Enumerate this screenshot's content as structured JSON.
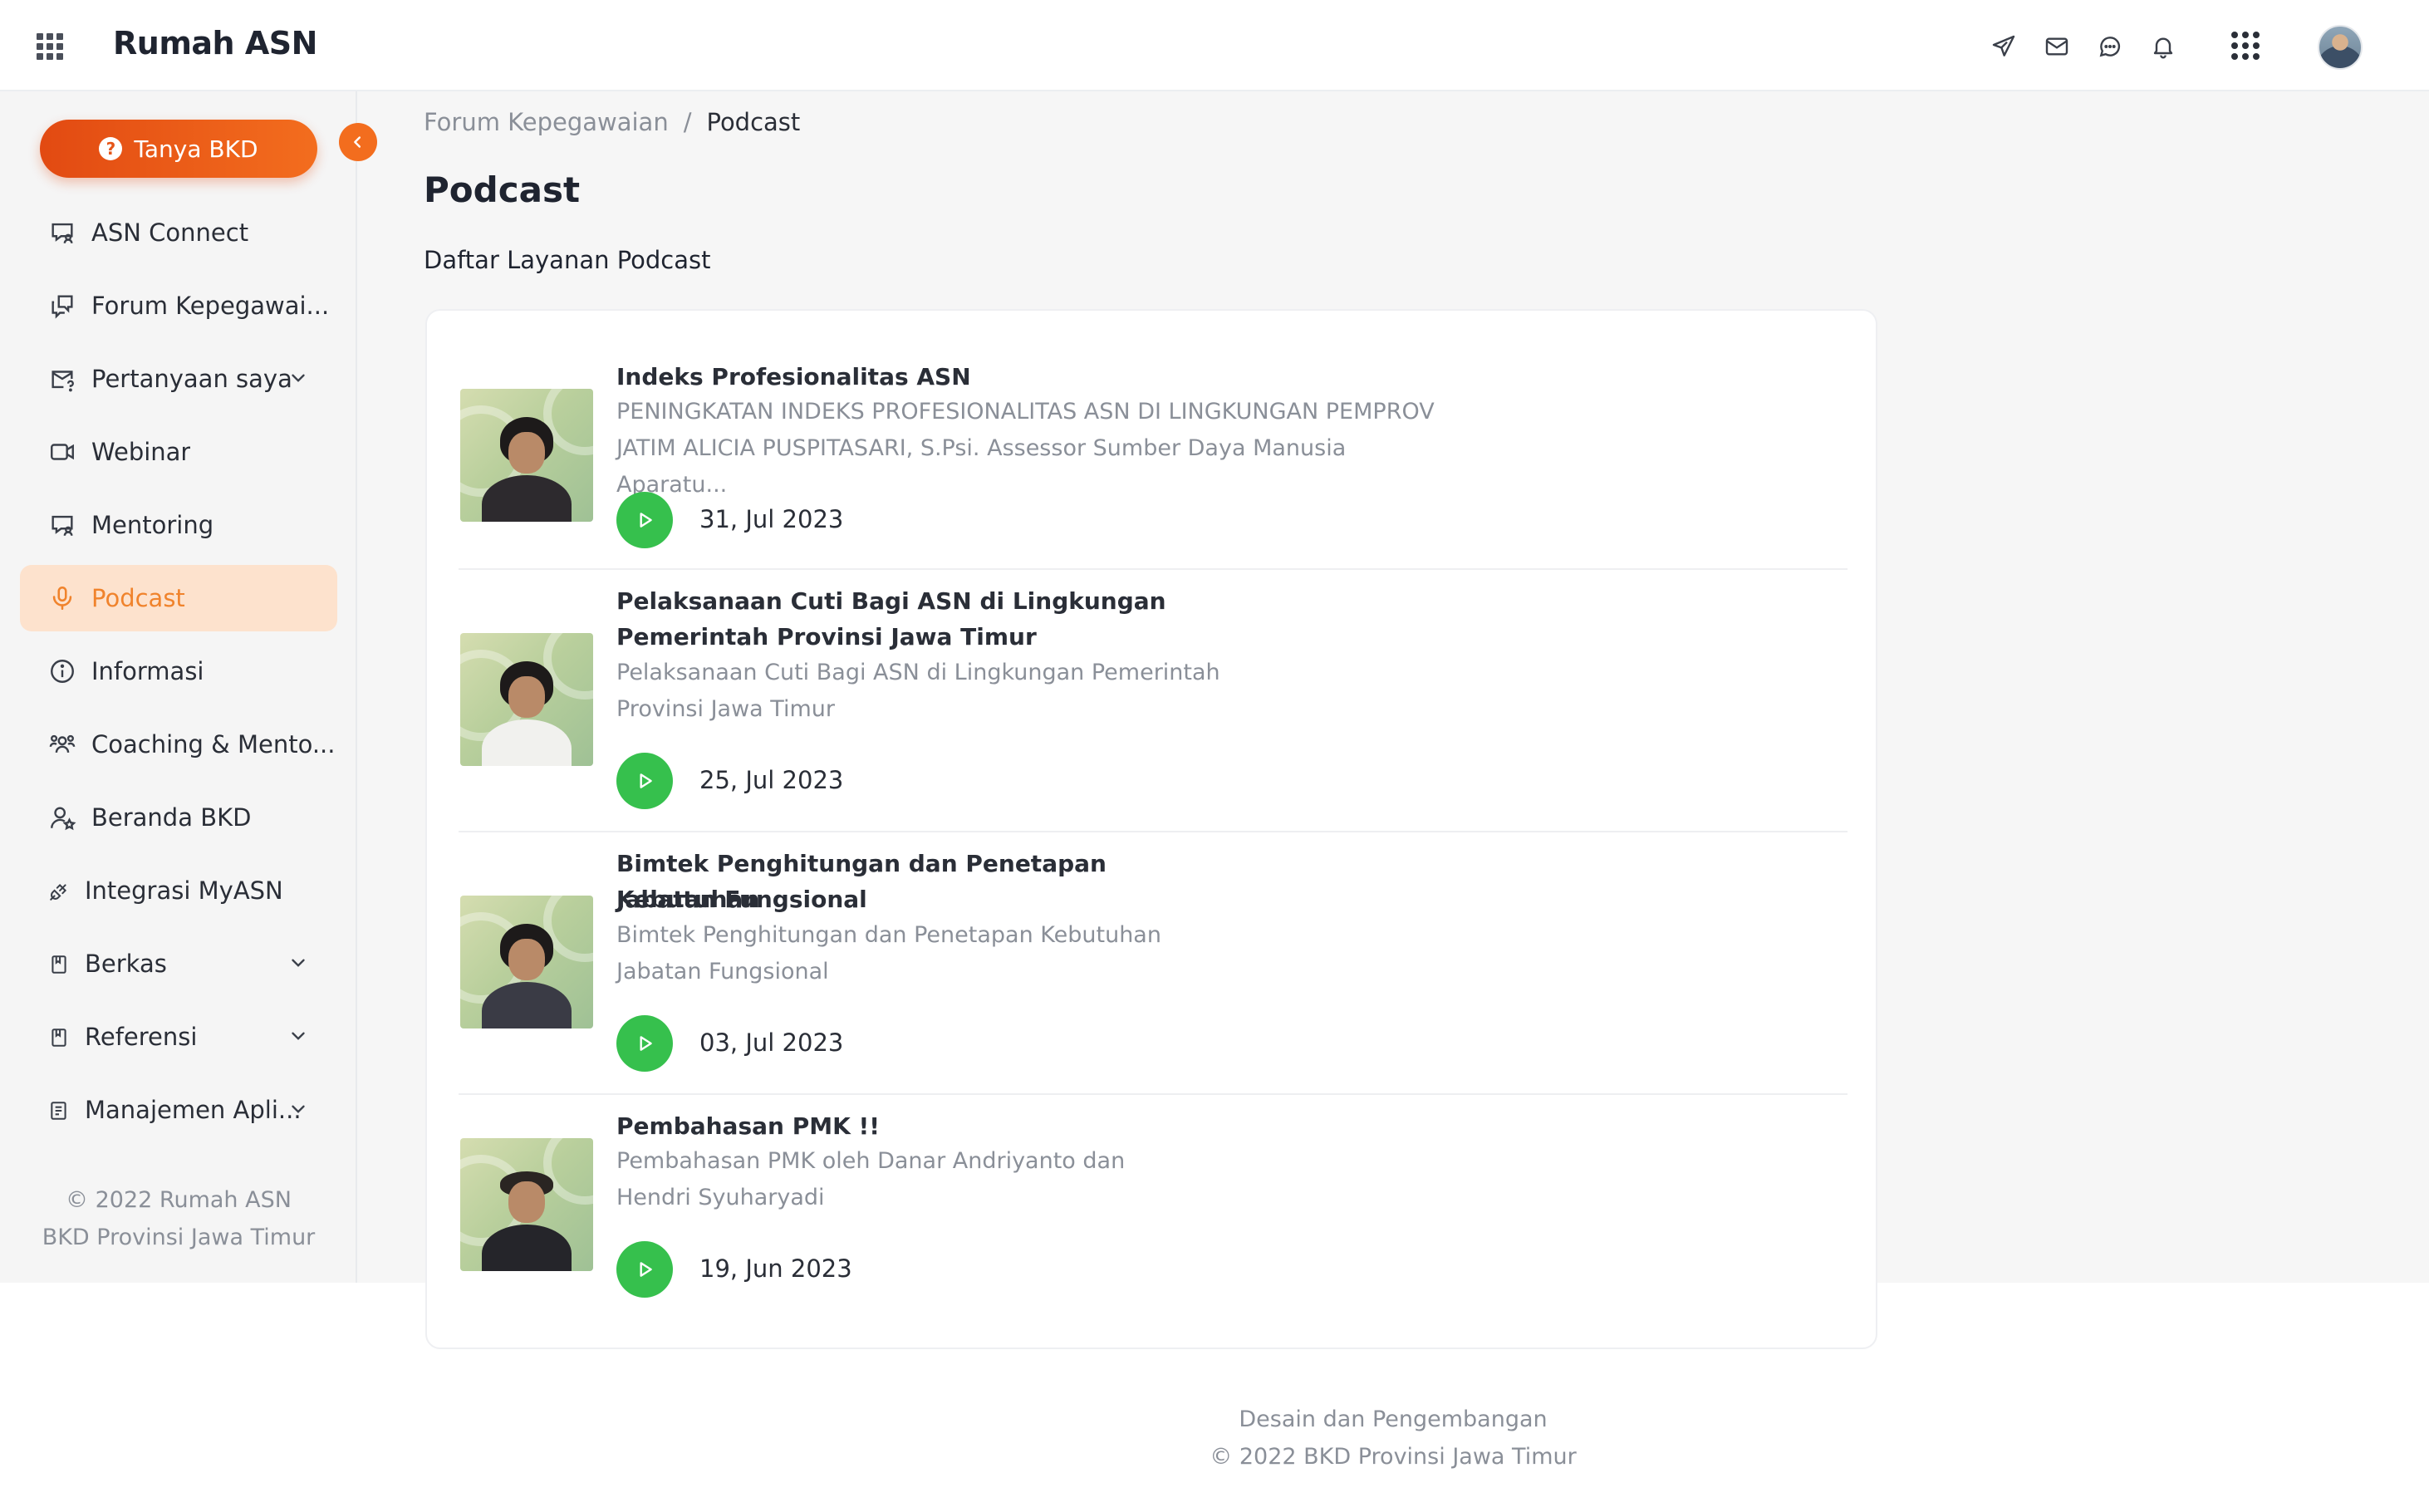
{
  "header": {
    "brand": "Rumah ASN",
    "icons": [
      "grid-menu-icon",
      "send-icon",
      "mail-icon",
      "chat-icon",
      "bell-icon",
      "apps-icon",
      "avatar"
    ]
  },
  "sidebar": {
    "cta_label": "Tanya BKD",
    "items": [
      {
        "label": "ASN Connect",
        "icon": "chat-user-icon"
      },
      {
        "label": "Forum Kepegawai...",
        "icon": "forum-icon"
      },
      {
        "label": "Pertanyaan saya",
        "icon": "mail-question-icon"
      },
      {
        "label": "Webinar",
        "icon": "video-icon"
      },
      {
        "label": "Mentoring",
        "icon": "mentoring-icon"
      },
      {
        "label": "Podcast",
        "icon": "microphone-icon",
        "active": true
      },
      {
        "label": "Informasi",
        "icon": "info-icon"
      },
      {
        "label": "Coaching & Mento...",
        "icon": "users-icon"
      },
      {
        "label": "Beranda BKD",
        "icon": "user-star-icon"
      },
      {
        "label": "Integrasi MyASN",
        "icon": "plug-icon"
      },
      {
        "label": "Berkas",
        "icon": "file-icon"
      },
      {
        "label": "Referensi",
        "icon": "book-icon"
      },
      {
        "label": "Manajemen Apli...",
        "icon": "app-manage-icon"
      }
    ],
    "copyright_line1": "© 2022 Rumah ASN",
    "copyright_line2": "BKD Provinsi Jawa Timur"
  },
  "breadcrumb": {
    "parent": "Forum Kepegawaian",
    "separator": "/",
    "current": "Podcast"
  },
  "page": {
    "title": "Podcast",
    "subtitle": "Daftar Layanan Podcast"
  },
  "podcasts": [
    {
      "title_line1": "Indeks Profesionalitas ASN",
      "title_line2": "",
      "desc_line1": "PENINGKATAN INDEKS PROFESIONALITAS ASN DI LINGKUNGAN PEMPROV",
      "desc_line2": "JATIM ALICIA PUSPITASARI, S.Psi. Assessor Sumber Daya Manusia Aparatu...",
      "date": "31, Jul 2023"
    },
    {
      "title_line1": "Pelaksanaan Cuti Bagi ASN di Lingkungan",
      "title_line2": "Pemerintah Provinsi Jawa Timur",
      "desc_line1": "Pelaksanaan Cuti Bagi ASN di Lingkungan Pemerintah",
      "desc_line2": "Provinsi Jawa Timur",
      "date": "25, Jul 2023"
    },
    {
      "title_line1": "Bimtek Penghitungan dan Penetapan Kebutuhan",
      "title_line2": "Jabatan Fungsional",
      "desc_line1": "Bimtek Penghitungan dan Penetapan Kebutuhan",
      "desc_line2": "Jabatan Fungsional",
      "date": "03, Jul 2023"
    },
    {
      "title_line1": "Pembahasan PMK !!",
      "title_line2": "",
      "desc_line1": "Pembahasan PMK oleh Danar Andriyanto dan",
      "desc_line2": "Hendri Syuharyadi",
      "date": "19, Jun 2023"
    }
  ],
  "footer": {
    "line1": "Desain dan Pengembangan",
    "line2": "© 2022 BKD Provinsi Jawa Timur"
  },
  "colors": {
    "accent": "#f36d1e",
    "active_bg": "#fde2cd",
    "active_text": "#f0832c",
    "play": "#36c04d"
  }
}
